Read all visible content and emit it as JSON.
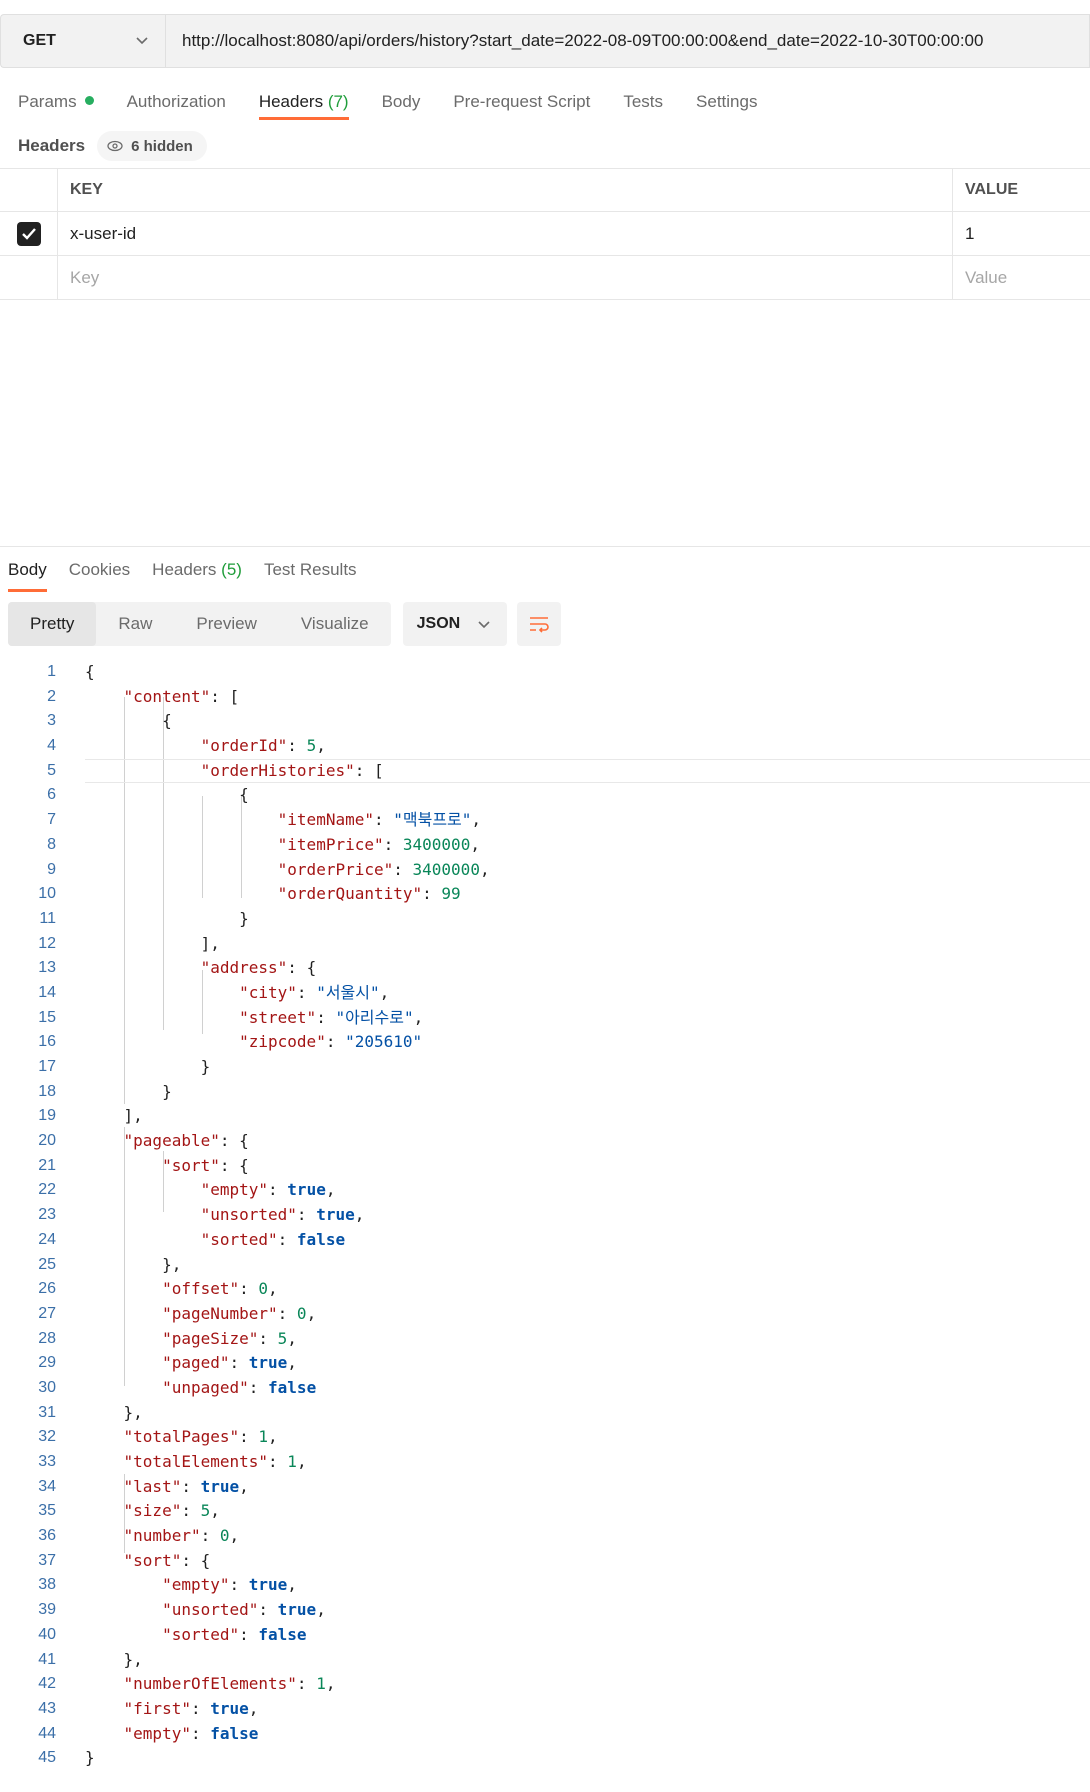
{
  "request": {
    "method": "GET",
    "url": "http://localhost:8080/api/orders/history?start_date=2022-08-09T00:00:00&end_date=2022-10-30T00:00:00"
  },
  "request_tabs": [
    {
      "label": "Params",
      "badge": ""
    },
    {
      "label": "Authorization",
      "badge": ""
    },
    {
      "label": "Headers",
      "badge": "(7)"
    },
    {
      "label": "Body",
      "badge": ""
    },
    {
      "label": "Pre-request Script",
      "badge": ""
    },
    {
      "label": "Tests",
      "badge": ""
    },
    {
      "label": "Settings",
      "badge": ""
    }
  ],
  "headers_section": {
    "title": "Headers",
    "hidden_label": "6 hidden",
    "col_key": "KEY",
    "col_value": "VALUE",
    "rows": [
      {
        "key": "x-user-id",
        "value": "1",
        "checked": true
      }
    ],
    "placeholder_key": "Key",
    "placeholder_value": "Value"
  },
  "response_tabs": [
    {
      "label": "Body",
      "badge": ""
    },
    {
      "label": "Cookies",
      "badge": ""
    },
    {
      "label": "Headers",
      "badge": "(5)"
    },
    {
      "label": "Test Results",
      "badge": ""
    }
  ],
  "view_modes": [
    "Pretty",
    "Raw",
    "Preview",
    "Visualize"
  ],
  "format": "JSON",
  "colors": {
    "accent": "#ff6c37",
    "success": "#27ae60",
    "json_key": "#a31515",
    "json_string": "#0451a5",
    "json_number": "#098658"
  },
  "code_lines": [
    "{",
    "    \"content\": [",
    "        {",
    "            \"orderId\": 5,",
    "            \"orderHistories\": [",
    "                {",
    "                    \"itemName\": \"맥북프로\",",
    "                    \"itemPrice\": 3400000,",
    "                    \"orderPrice\": 3400000,",
    "                    \"orderQuantity\": 99",
    "                }",
    "            ],",
    "            \"address\": {",
    "                \"city\": \"서울시\",",
    "                \"street\": \"아리수로\",",
    "                \"zipcode\": \"205610\"",
    "            }",
    "        }",
    "    ],",
    "    \"pageable\": {",
    "        \"sort\": {",
    "            \"empty\": true,",
    "            \"unsorted\": true,",
    "            \"sorted\": false",
    "        },",
    "        \"offset\": 0,",
    "        \"pageNumber\": 0,",
    "        \"pageSize\": 5,",
    "        \"paged\": true,",
    "        \"unpaged\": false",
    "    },",
    "    \"totalPages\": 1,",
    "    \"totalElements\": 1,",
    "    \"last\": true,",
    "    \"size\": 5,",
    "    \"number\": 0,",
    "    \"sort\": {",
    "        \"empty\": true,",
    "        \"unsorted\": true,",
    "        \"sorted\": false",
    "    },",
    "    \"numberOfElements\": 1,",
    "    \"first\": true,",
    "    \"empty\": false",
    "}"
  ]
}
